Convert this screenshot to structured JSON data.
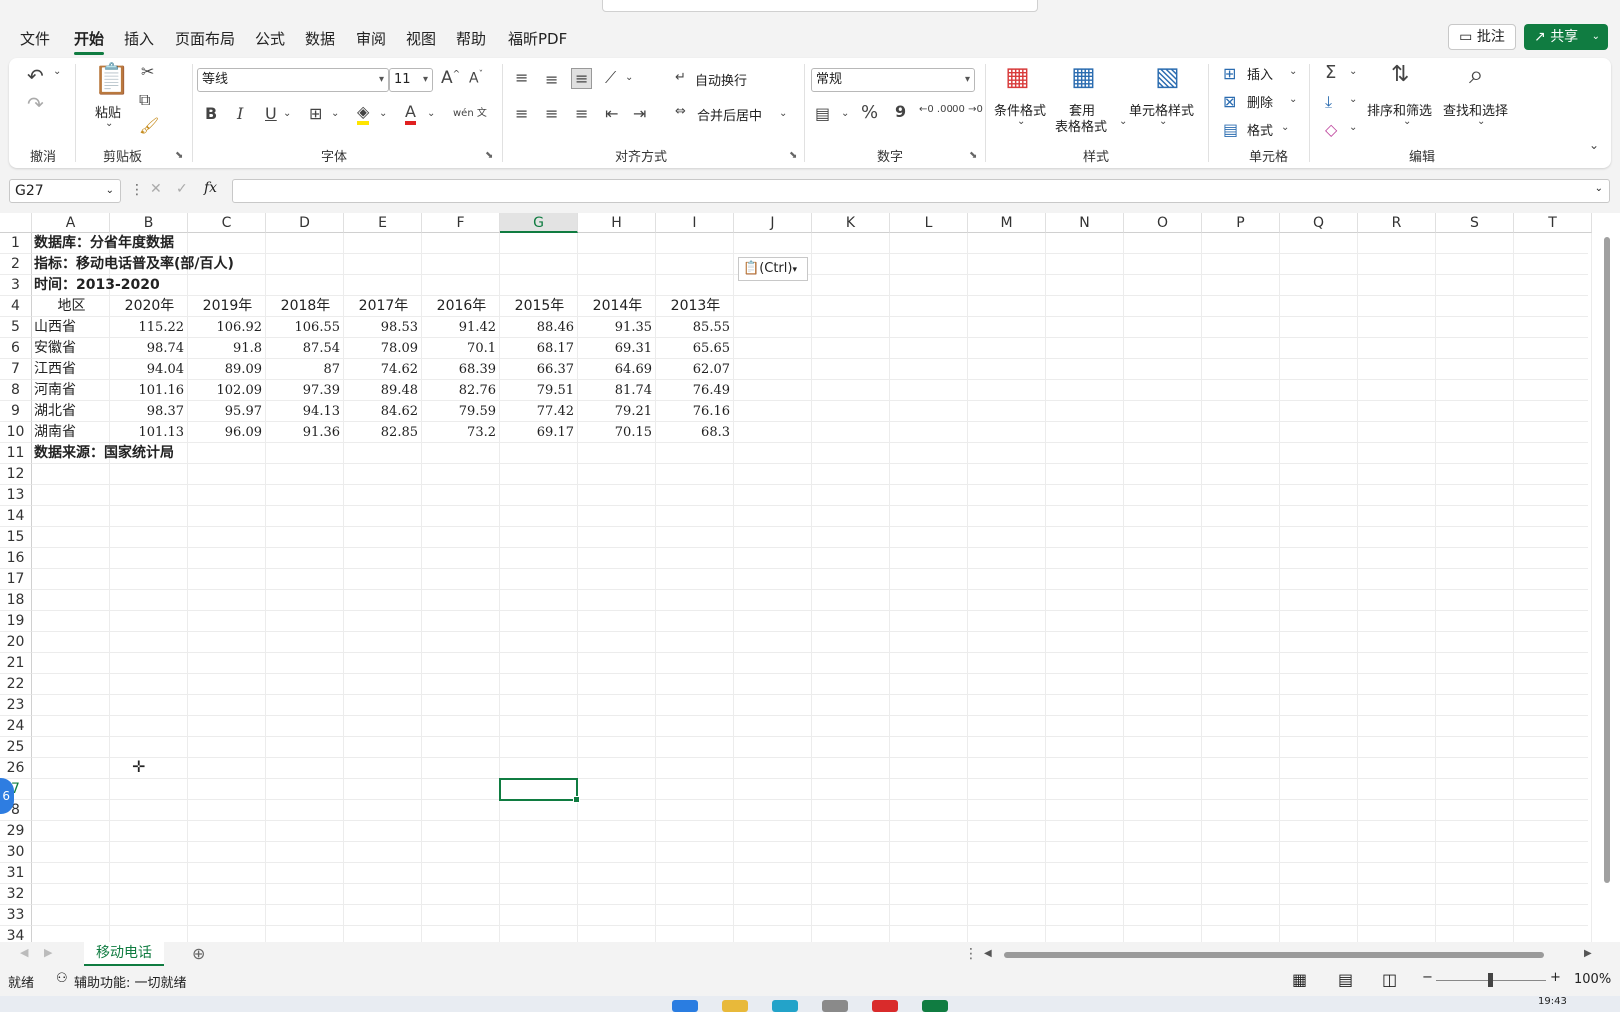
{
  "tabs": [
    "文件",
    "开始",
    "插入",
    "页面布局",
    "公式",
    "数据",
    "审阅",
    "视图",
    "帮助",
    "福昕PDF"
  ],
  "active_tab": "开始",
  "buttons": {
    "comment": "批注",
    "share": "共享"
  },
  "ribbon": {
    "undo_group": "撤消",
    "clipboard": {
      "paste": "粘贴",
      "group": "剪贴板"
    },
    "font": {
      "name": "等线",
      "size": "11",
      "group": "字体",
      "bold": "B",
      "italic": "I",
      "underline": "U",
      "font_color_glyph": "A",
      "phonetic": "wén 文"
    },
    "alignment": {
      "wrap": "自动换行",
      "merge": "合并后居中",
      "group": "对齐方式"
    },
    "number": {
      "format": "常规",
      "percent": "%",
      "comma": "9",
      "inc_dec": "←0 .00",
      "dec_dec": ".00 →0",
      "group": "数字"
    },
    "styles": {
      "cond_format": "条件格式",
      "table_format_1": "套用",
      "table_format_2": "表格格式",
      "cell_styles": "单元格样式",
      "group": "样式"
    },
    "cells": {
      "insert": "插入",
      "delete": "删除",
      "format": "格式",
      "group": "单元格"
    },
    "editing": {
      "sum": "Σ",
      "sort_filter": "排序和筛选",
      "find_select": "查找和选择",
      "group": "编辑"
    }
  },
  "formula_bar": {
    "name_box": "G27",
    "fx": "fx",
    "value": ""
  },
  "columns": [
    "A",
    "B",
    "C",
    "D",
    "E",
    "F",
    "G",
    "H",
    "I",
    "J",
    "K",
    "L",
    "M",
    "N",
    "O",
    "P",
    "Q",
    "R",
    "S",
    "T"
  ],
  "selected_column": "G",
  "selected_row": 27,
  "rows": [
    [
      "数据库：分省年度数据"
    ],
    [
      "指标：移动电话普及率(部/百人)"
    ],
    [
      "时间：2013-2020"
    ],
    [
      "地区",
      "2020年",
      "2019年",
      "2018年",
      "2017年",
      "2016年",
      "2015年",
      "2014年",
      "2013年"
    ],
    [
      "山西省",
      "115.22",
      "106.92",
      "106.55",
      "98.53",
      "91.42",
      "88.46",
      "91.35",
      "85.55"
    ],
    [
      "安徽省",
      "98.74",
      "91.8",
      "87.54",
      "78.09",
      "70.1",
      "68.17",
      "69.31",
      "65.65"
    ],
    [
      "江西省",
      "94.04",
      "89.09",
      "87",
      "74.62",
      "68.39",
      "66.37",
      "64.69",
      "62.07"
    ],
    [
      "河南省",
      "101.16",
      "102.09",
      "97.39",
      "89.48",
      "82.76",
      "79.51",
      "81.74",
      "76.49"
    ],
    [
      "湖北省",
      "98.37",
      "95.97",
      "94.13",
      "84.62",
      "79.59",
      "77.42",
      "79.21",
      "76.16"
    ],
    [
      "湖南省",
      "101.13",
      "96.09",
      "91.36",
      "82.85",
      "73.2",
      "69.17",
      "70.15",
      "68.3"
    ],
    [
      "数据来源：国家统计局"
    ]
  ],
  "row_numbers": [
    "1",
    "2",
    "3",
    "4",
    "5",
    "6",
    "7",
    "8",
    "9",
    "10",
    "11",
    "12",
    "13",
    "14",
    "15",
    "16",
    "17",
    "18",
    "19",
    "20",
    "21",
    "22",
    "23",
    "24",
    "25",
    "26",
    "7",
    "8",
    "29",
    "30",
    "31",
    "32",
    "33",
    "34"
  ],
  "paste_options": "(Ctrl)",
  "sheet_tab": "移动电话",
  "status": {
    "ready": "就绪",
    "accessibility": "辅助功能: 一切就绪",
    "zoom": "100%"
  },
  "side_badge": "6",
  "taskbar_time": "19:43",
  "colors": {
    "accent": "#107c41",
    "selection": "#107c41"
  }
}
